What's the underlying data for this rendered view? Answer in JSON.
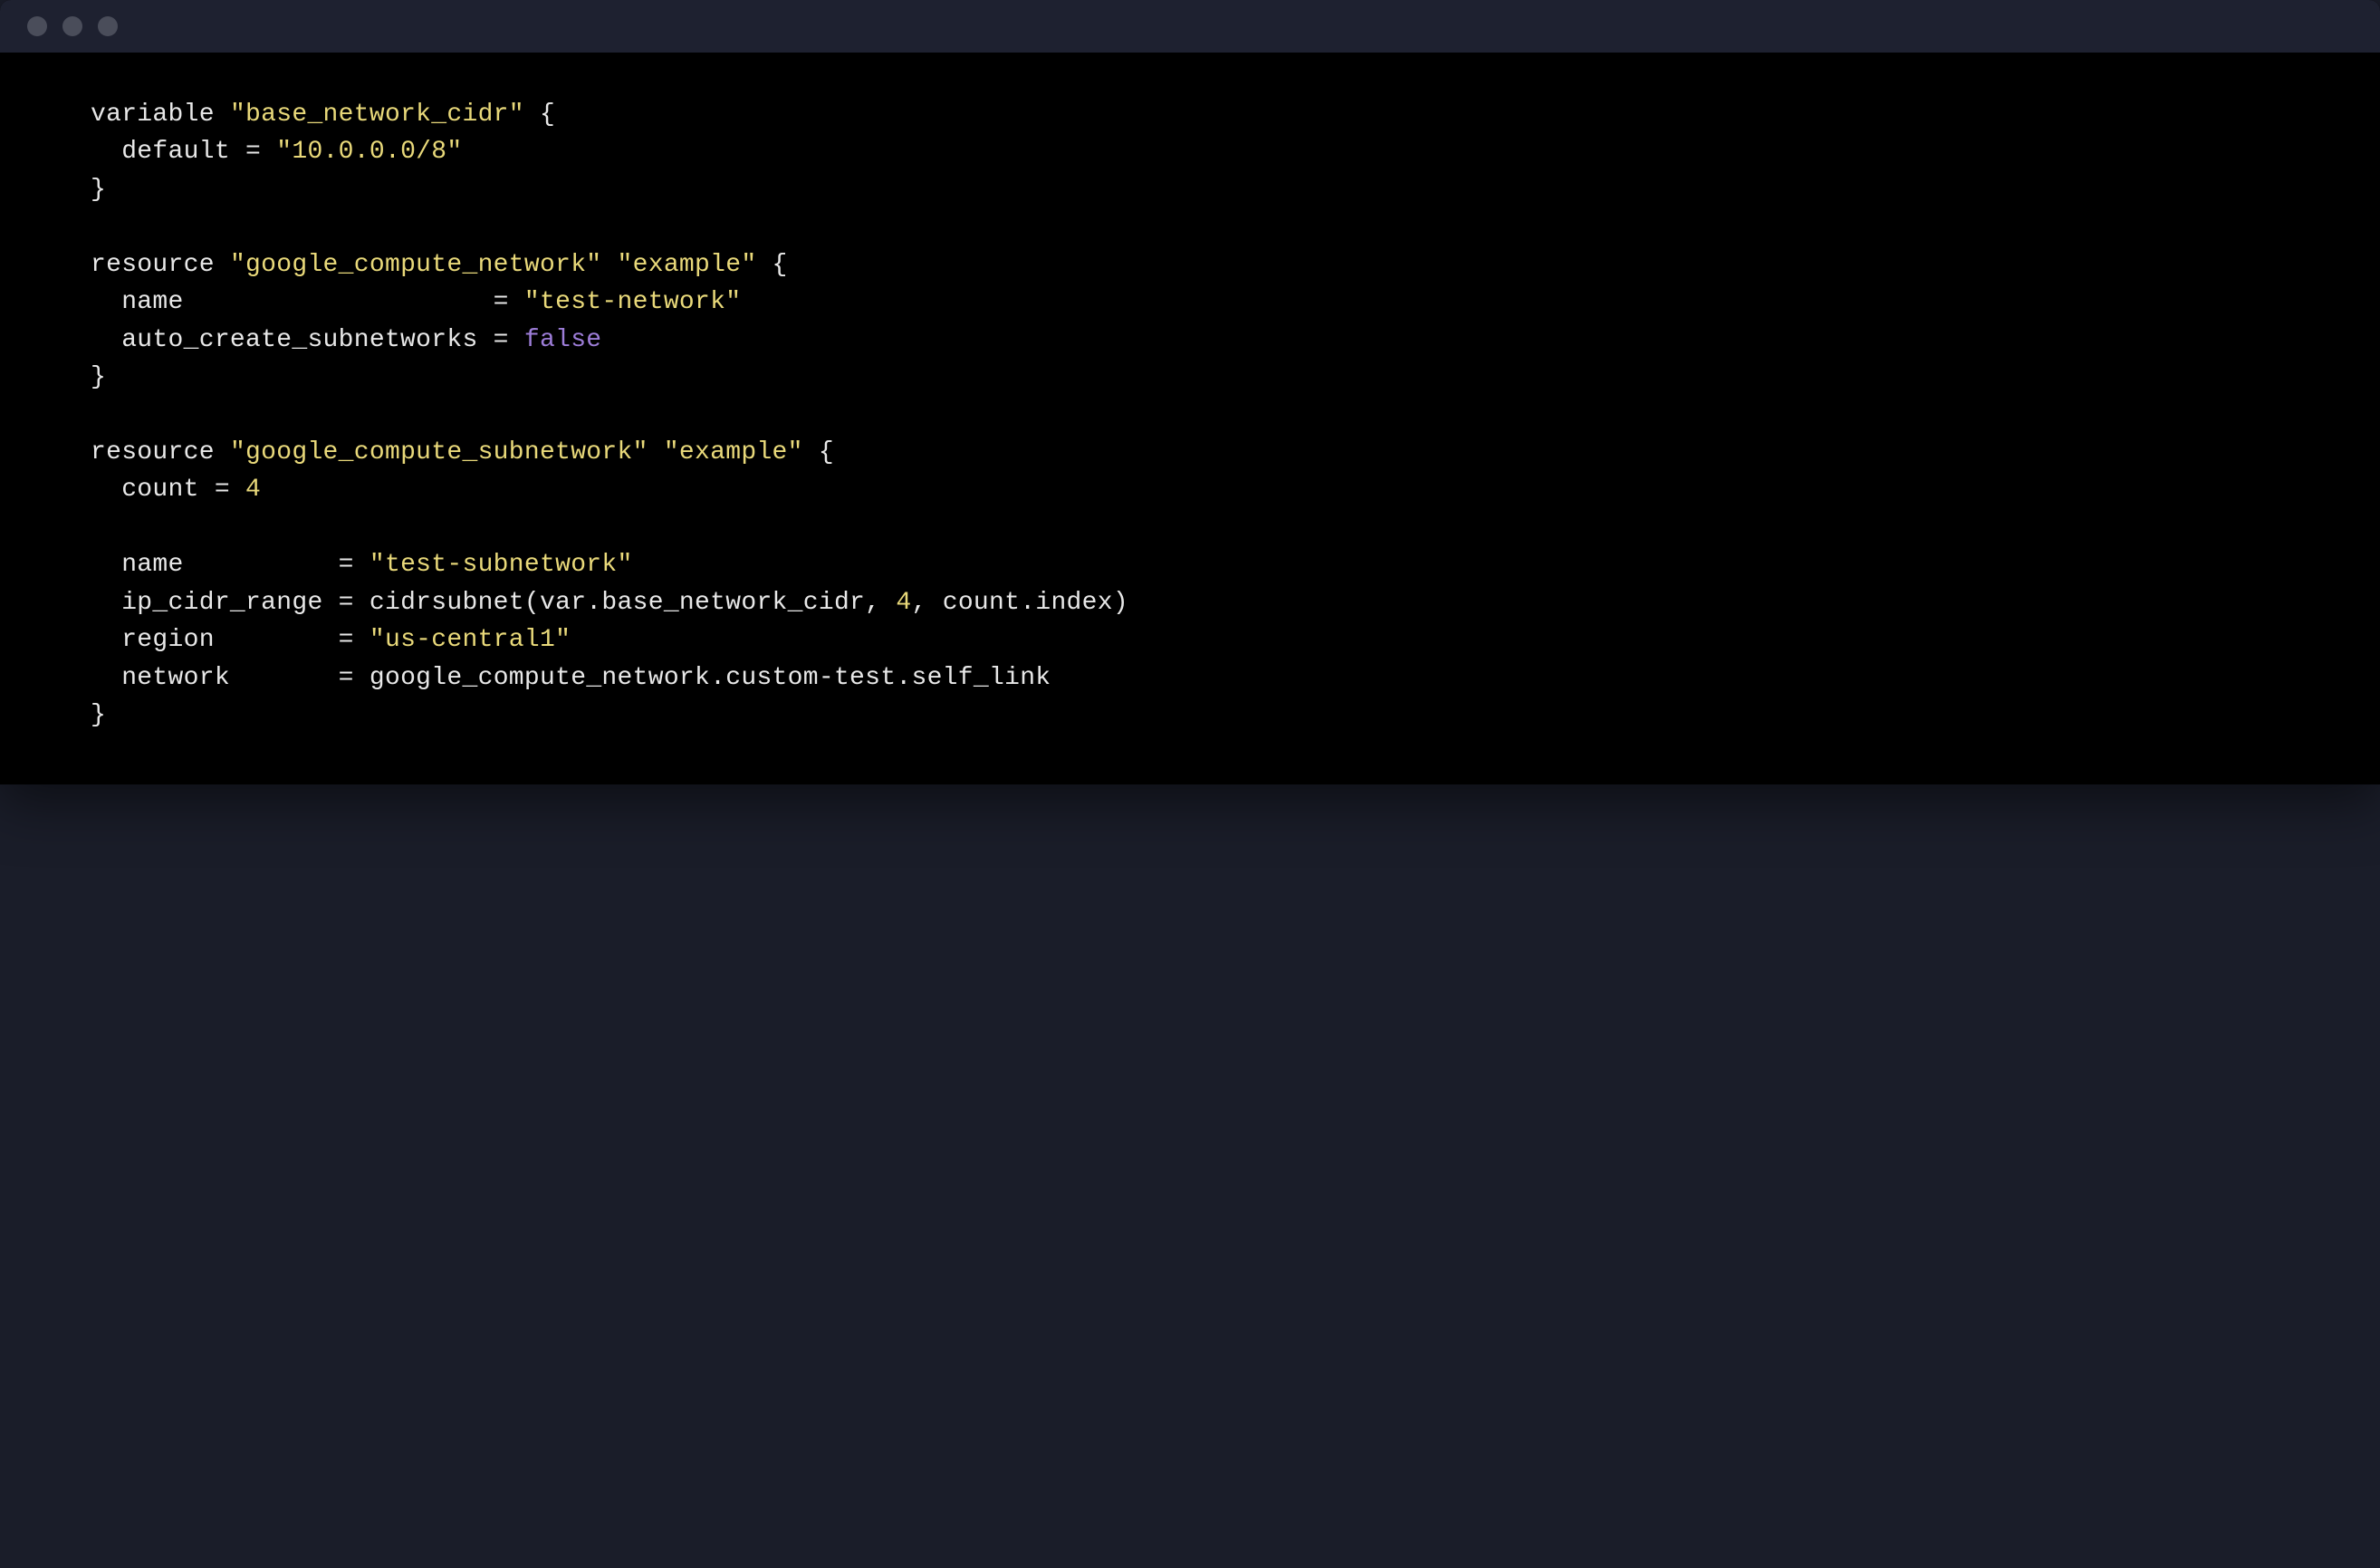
{
  "titlebar": {
    "buttons": [
      "close",
      "minimize",
      "maximize"
    ]
  },
  "code": {
    "l1_kw": "variable",
    "l1_str": "\"base_network_cidr\"",
    "l1_brace": " {",
    "l2_ident": "  default",
    "l2_eq": " = ",
    "l2_str": "\"10.0.0.0/8\"",
    "l3_brace": "}",
    "l5_kw": "resource",
    "l5_str1": "\"google_compute_network\"",
    "l5_sp": " ",
    "l5_str2": "\"example\"",
    "l5_brace": " {",
    "l6_ident": "  name",
    "l6_pad": "                    = ",
    "l6_str": "\"test-network\"",
    "l7_ident": "  auto_create_subnetworks",
    "l7_eq": " = ",
    "l7_bool": "false",
    "l8_brace": "}",
    "l10_kw": "resource",
    "l10_str1": "\"google_compute_subnetwork\"",
    "l10_sp": " ",
    "l10_str2": "\"example\"",
    "l10_brace": " {",
    "l11_ident": "  count",
    "l11_eq": " = ",
    "l11_num": "4",
    "l13_ident": "  name",
    "l13_pad": "          = ",
    "l13_str": "\"test-subnetwork\"",
    "l14_ident": "  ip_cidr_range",
    "l14_eq": " = ",
    "l14_fn": "cidrsubnet",
    "l14_paren_o": "(",
    "l14_arg1": "var.base_network_cidr",
    "l14_c1": ", ",
    "l14_arg2": "4",
    "l14_c2": ", ",
    "l14_arg3": "count.index",
    "l14_paren_c": ")",
    "l15_ident": "  region",
    "l15_pad": "        = ",
    "l15_str": "\"us-central1\"",
    "l16_ident": "  network",
    "l16_pad": "       = ",
    "l16_val": "google_compute_network.custom-test.self_link",
    "l17_brace": "}"
  }
}
